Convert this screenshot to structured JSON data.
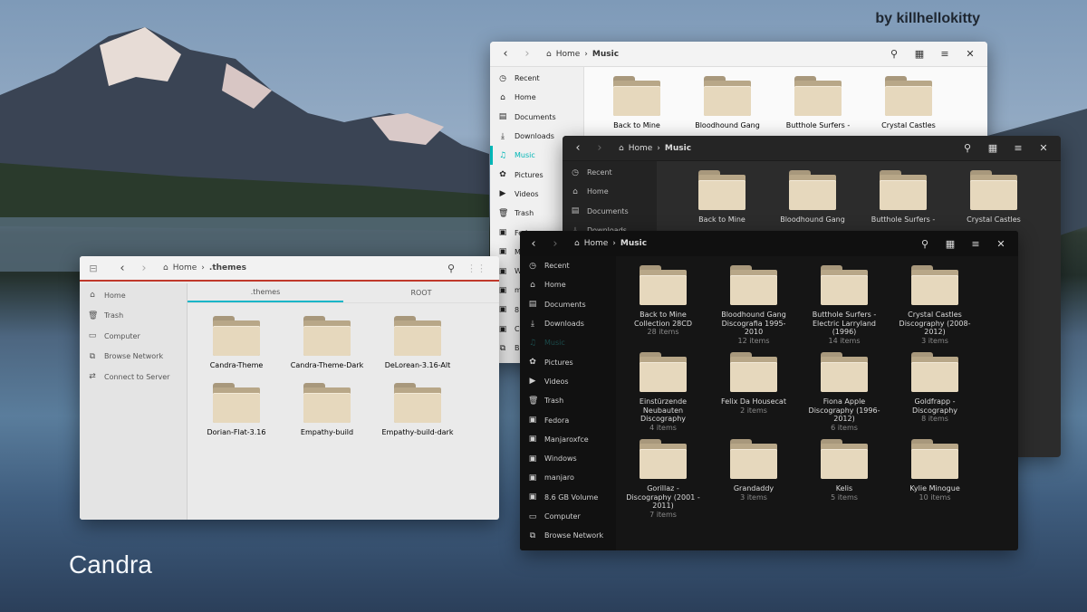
{
  "credit": "by killhellokitty",
  "theme_name": "Candra",
  "light_window": {
    "breadcrumb": {
      "home": "Home",
      "current": "Music"
    },
    "sidebar": [
      {
        "icon": "clock-icon",
        "label": "Recent"
      },
      {
        "icon": "home-icon",
        "label": "Home"
      },
      {
        "icon": "document-icon",
        "label": "Documents"
      },
      {
        "icon": "download-icon",
        "label": "Downloads"
      },
      {
        "icon": "music-icon",
        "label": "Music",
        "active": true
      },
      {
        "icon": "pictures-icon",
        "label": "Pictures"
      },
      {
        "icon": "video-icon",
        "label": "Videos"
      },
      {
        "icon": "trash-icon",
        "label": "Trash"
      },
      {
        "icon": "drive-icon",
        "label": "Fedo"
      },
      {
        "icon": "drive-icon",
        "label": "M"
      },
      {
        "icon": "drive-icon",
        "label": "W"
      },
      {
        "icon": "drive-icon",
        "label": "m"
      },
      {
        "icon": "drive-icon",
        "label": "8."
      },
      {
        "icon": "drive-icon",
        "label": "Co"
      },
      {
        "icon": "network-icon",
        "label": "Br"
      }
    ],
    "folders": [
      {
        "name": "Back to Mine"
      },
      {
        "name": "Bloodhound Gang"
      },
      {
        "name": "Butthole Surfers -"
      },
      {
        "name": "Crystal Castles"
      }
    ]
  },
  "mid_window": {
    "breadcrumb": {
      "home": "Home",
      "current": "Music"
    },
    "sidebar": [
      {
        "icon": "clock-icon",
        "label": "Recent"
      },
      {
        "icon": "home-icon",
        "label": "Home"
      },
      {
        "icon": "document-icon",
        "label": "Documents"
      },
      {
        "icon": "download-icon",
        "label": "Downloads"
      }
    ],
    "folders": [
      {
        "name": "Back to Mine"
      },
      {
        "name": "Bloodhound Gang"
      },
      {
        "name": "Butthole Surfers -"
      },
      {
        "name": "Crystal Castles"
      }
    ]
  },
  "left_window": {
    "breadcrumb": {
      "home": "Home",
      "current": ".themes"
    },
    "tabs": [
      {
        "label": ".themes",
        "active": true
      },
      {
        "label": "ROOT"
      }
    ],
    "sidebar": [
      {
        "icon": "home-icon",
        "label": "Home"
      },
      {
        "icon": "trash-icon",
        "label": "Trash"
      },
      {
        "icon": "computer-icon",
        "label": "Computer"
      },
      {
        "icon": "network-icon",
        "label": "Browse Network"
      },
      {
        "icon": "server-icon",
        "label": "Connect to Server"
      }
    ],
    "folders": [
      {
        "name": "Candra-Theme"
      },
      {
        "name": "Candra-Theme-Dark"
      },
      {
        "name": "DeLorean-3.16-Alt"
      },
      {
        "name": "Dorian-Flat-3.16"
      },
      {
        "name": "Empathy-build"
      },
      {
        "name": "Empathy-build-dark"
      }
    ]
  },
  "front_window": {
    "breadcrumb": {
      "home": "Home",
      "current": "Music"
    },
    "sidebar": [
      {
        "icon": "clock-icon",
        "label": "Recent"
      },
      {
        "icon": "home-icon",
        "label": "Home"
      },
      {
        "icon": "document-icon",
        "label": "Documents"
      },
      {
        "icon": "download-icon",
        "label": "Downloads"
      },
      {
        "icon": "music-icon",
        "label": "Music",
        "selected": true
      },
      {
        "icon": "pictures-icon",
        "label": "Pictures"
      },
      {
        "icon": "video-icon",
        "label": "Videos"
      },
      {
        "icon": "trash-icon",
        "label": "Trash"
      },
      {
        "icon": "drive-icon",
        "label": "Fedora"
      },
      {
        "icon": "drive-icon",
        "label": "Manjaroxfce"
      },
      {
        "icon": "drive-icon",
        "label": "Windows"
      },
      {
        "icon": "drive-icon",
        "label": "manjaro"
      },
      {
        "icon": "drive-icon",
        "label": "8.6 GB Volume"
      },
      {
        "icon": "computer-icon",
        "label": "Computer"
      },
      {
        "icon": "network-icon",
        "label": "Browse Network"
      }
    ],
    "folders": [
      {
        "name": "Back to Mine Collection 28CD",
        "count": "28 items"
      },
      {
        "name": "Bloodhound Gang Discografia 1995-2010",
        "count": "12 items"
      },
      {
        "name": "Butthole Surfers - Electric Larryland (1996)",
        "count": "14 items"
      },
      {
        "name": "Crystal Castles Discography (2008-2012)",
        "count": "3 items"
      },
      {
        "name": "Einstürzende Neubauten Discography",
        "count": "4 items"
      },
      {
        "name": "Felix Da Housecat",
        "count": "2 items"
      },
      {
        "name": "Fiona Apple Discography (1996-2012)",
        "count": "6 items"
      },
      {
        "name": "Goldfrapp - Discography",
        "count": "8 items"
      },
      {
        "name": "Gorillaz - Discography (2001 - 2011)",
        "count": "7 items"
      },
      {
        "name": "Grandaddy",
        "count": "3 items"
      },
      {
        "name": "Kelis",
        "count": "5 items"
      },
      {
        "name": "Kylie Minogue",
        "count": "10 items"
      }
    ]
  }
}
